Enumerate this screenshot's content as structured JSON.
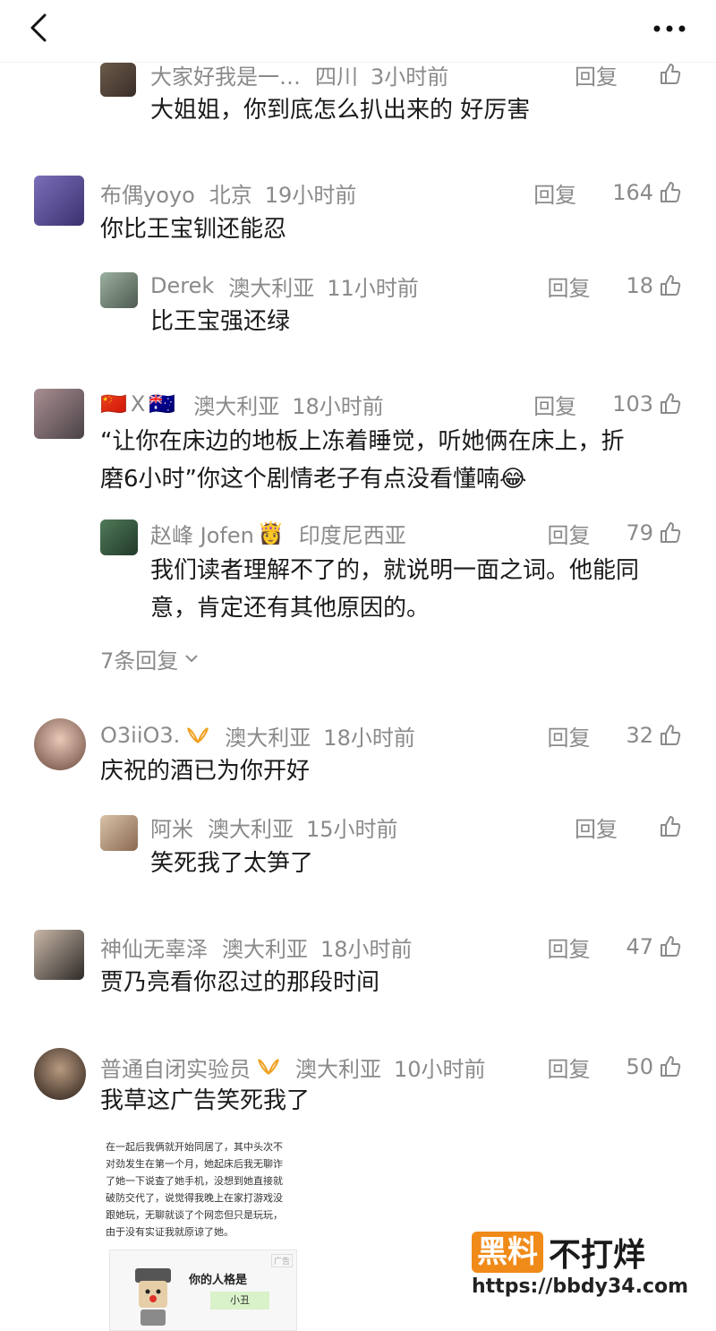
{
  "header": {
    "back_icon": "back-arrow-icon",
    "more_icon": "more-dots-icon"
  },
  "comments": [
    {
      "name": "大家好我是一…",
      "loc": "四川",
      "time": "3小时前",
      "reply": "回复",
      "likes": "",
      "text": [
        "大姐姐，你到底怎么扒出来的 好厉害"
      ]
    },
    {
      "name": "布偶yoyo",
      "loc": "北京",
      "time": "19小时前",
      "reply": "回复",
      "likes": "164",
      "text": [
        "你比王宝钏还能忍"
      ]
    },
    {
      "name": "Derek",
      "loc": "澳大利亚",
      "time": "11小时前",
      "reply": "回复",
      "likes": "18",
      "text": [
        "比王宝强还绿"
      ]
    },
    {
      "name": "X",
      "flags": [
        "🇨🇳",
        "🇦🇺"
      ],
      "loc": "澳大利亚",
      "time": "18小时前",
      "reply": "回复",
      "likes": "103",
      "text": [
        "“让你在床边的地板上冻着睡觉，听她俩在床上，折",
        "磨6小时”你这个剧情老子有点没看懂喃😂"
      ]
    },
    {
      "name": "赵峰 Jofen",
      "badge": "👸",
      "loc": "印度尼西亚",
      "time": "",
      "reply": "回复",
      "likes": "79",
      "text": [
        "我们读者理解不了的，就说明一面之词。他能同",
        "意，肯定还有其他原因的。"
      ]
    },
    {
      "name": "O3iiO3.",
      "loc": "澳大利亚",
      "time": "18小时前",
      "reply": "回复",
      "likes": "32",
      "text": [
        "庆祝的酒已为你开好"
      ]
    },
    {
      "name": "阿米",
      "loc": "澳大利亚",
      "time": "15小时前",
      "reply": "回复",
      "likes": "",
      "text": [
        "笑死我了太笋了"
      ]
    },
    {
      "name": "神仙无辜泽",
      "loc": "澳大利亚",
      "time": "18小时前",
      "reply": "回复",
      "likes": "47",
      "text": [
        "贾乃亮看你忍过的那段时间"
      ]
    },
    {
      "name": "普通自闭实验员",
      "loc": "澳大利亚",
      "time": "10小时前",
      "reply": "回复",
      "likes": "50",
      "text": [
        "我草这广告笑死我了"
      ]
    }
  ],
  "more_replies": "7条回复",
  "ad_image": {
    "lines": [
      "在一起后我俩就开始同居了，其中头次不",
      "对劲发生在第一个月，她起床后我无聊诈",
      "了她一下说查了她手机，没想到她直接就",
      "破防交代了，说觉得我晚上在家打游戏没",
      "跟她玩，无聊就谈了个网恋但只是玩玩，",
      "由于没有实证我就原谅了她。"
    ],
    "tag": "广告",
    "question": "你的人格是",
    "answer": "小丑"
  },
  "watermark": {
    "part1": "黑料",
    "part2": "不打烊",
    "url": "https://bbdy34.com"
  },
  "colors": {
    "meta_gray": "#8a8a8a",
    "brand_orange": "#f08a18"
  }
}
